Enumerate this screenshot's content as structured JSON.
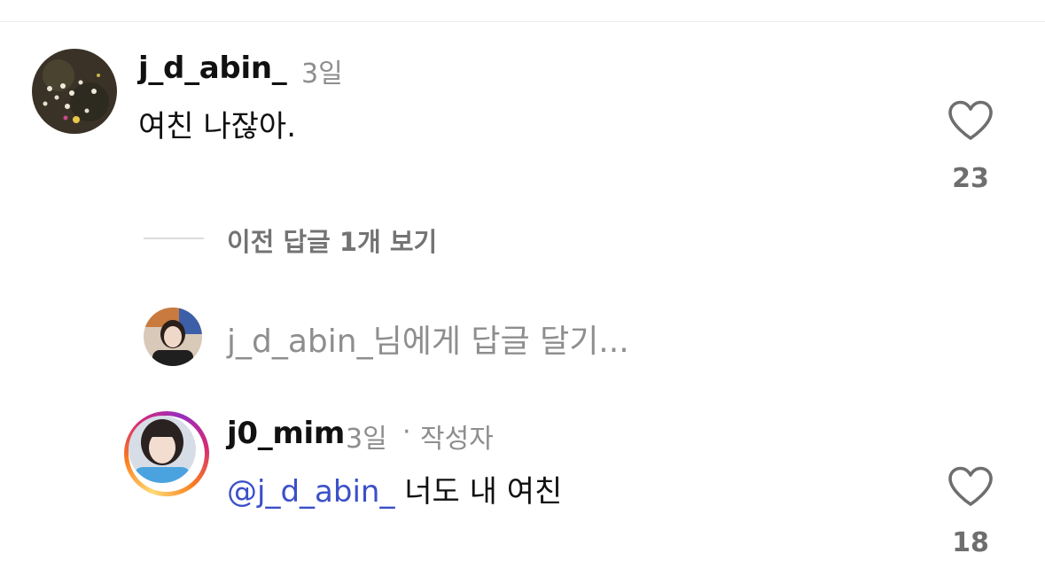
{
  "comment": {
    "username": "j_d_abin_",
    "time": "3일",
    "text": "여친 나잖아.",
    "like_count": "23",
    "view_replies": "이전 답글 1개 보기"
  },
  "reply_input": {
    "placeholder": "j_d_abin_님에게 답글 달기..."
  },
  "reply": {
    "username": "j0_mim",
    "time": "3일",
    "separator": "·",
    "author_badge": "작성자",
    "mention": "@j_d_abin_",
    "text": "너도 내 여친",
    "like_count": "18"
  },
  "icons": {
    "like": "heart-outline-icon"
  }
}
